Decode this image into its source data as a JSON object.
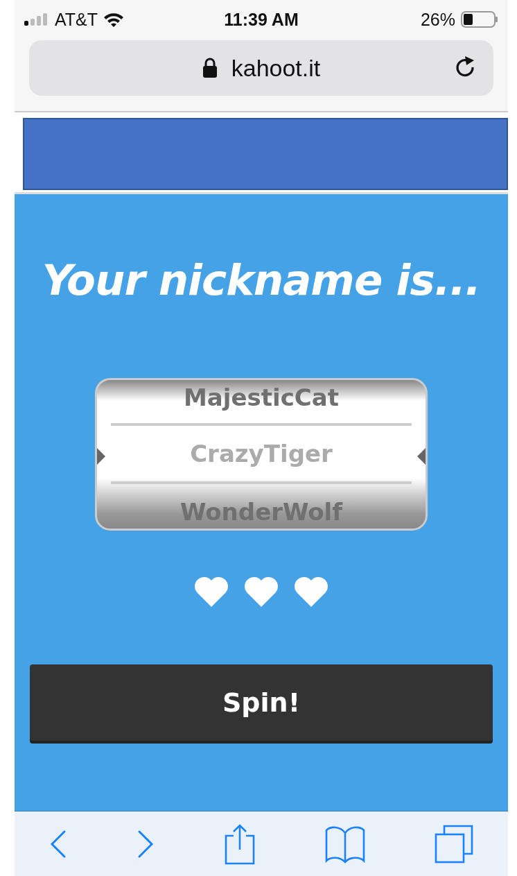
{
  "status_bar": {
    "carrier": "AT&T",
    "time": "11:39 AM",
    "battery": "26%"
  },
  "address_bar": {
    "url": "kahoot.it"
  },
  "title": "Your nickname is...",
  "nicknames": [
    {
      "name": "MajesticCat",
      "selected": false
    },
    {
      "name": "CrazyTiger",
      "selected": true
    },
    {
      "name": "WonderWolf",
      "selected": false
    }
  ],
  "spin_button": "Spin!"
}
